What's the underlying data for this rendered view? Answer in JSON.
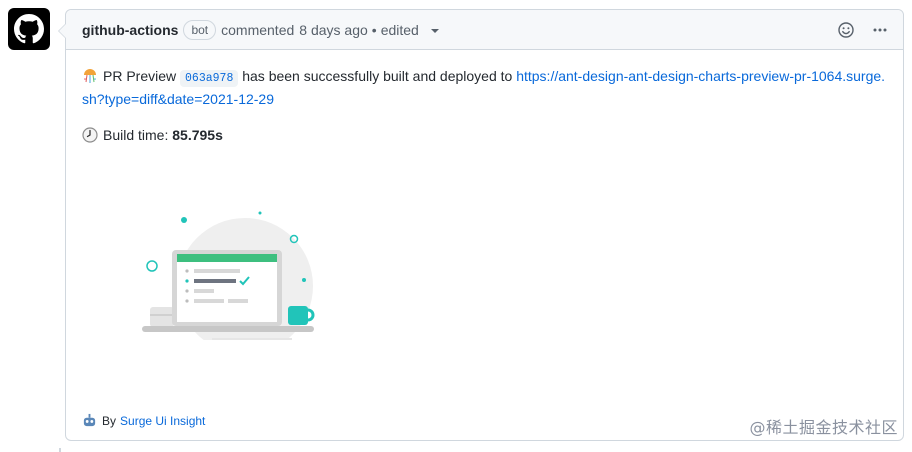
{
  "comment": {
    "author": "github-actions",
    "bot_label": "bot",
    "action": "commented",
    "time_ago": "8 days ago",
    "separator": "•",
    "edited": "edited"
  },
  "body": {
    "preview_text": "PR Preview",
    "commit_hash": "063a978",
    "deployed_text": "has been successfully built and deployed to",
    "link_text": "https://ant-design-ant-design-charts-preview-pr-1064.surge.sh?type=diff&date=2021-12-29",
    "build_time_label": "Build time:",
    "build_time_value": "85.795s"
  },
  "footer": {
    "by_text": "By",
    "link_text": "Surge Ui Insight"
  },
  "watermark": "@稀土掘金技术社区",
  "colors": {
    "link": "#0969da",
    "accent_green": "#3dbf7f",
    "accent_teal": "#21c4b9"
  },
  "icons": {
    "avatar": "github-octocat-icon",
    "emoji_react": "smiley-icon",
    "more": "kebab-horizontal-icon"
  }
}
